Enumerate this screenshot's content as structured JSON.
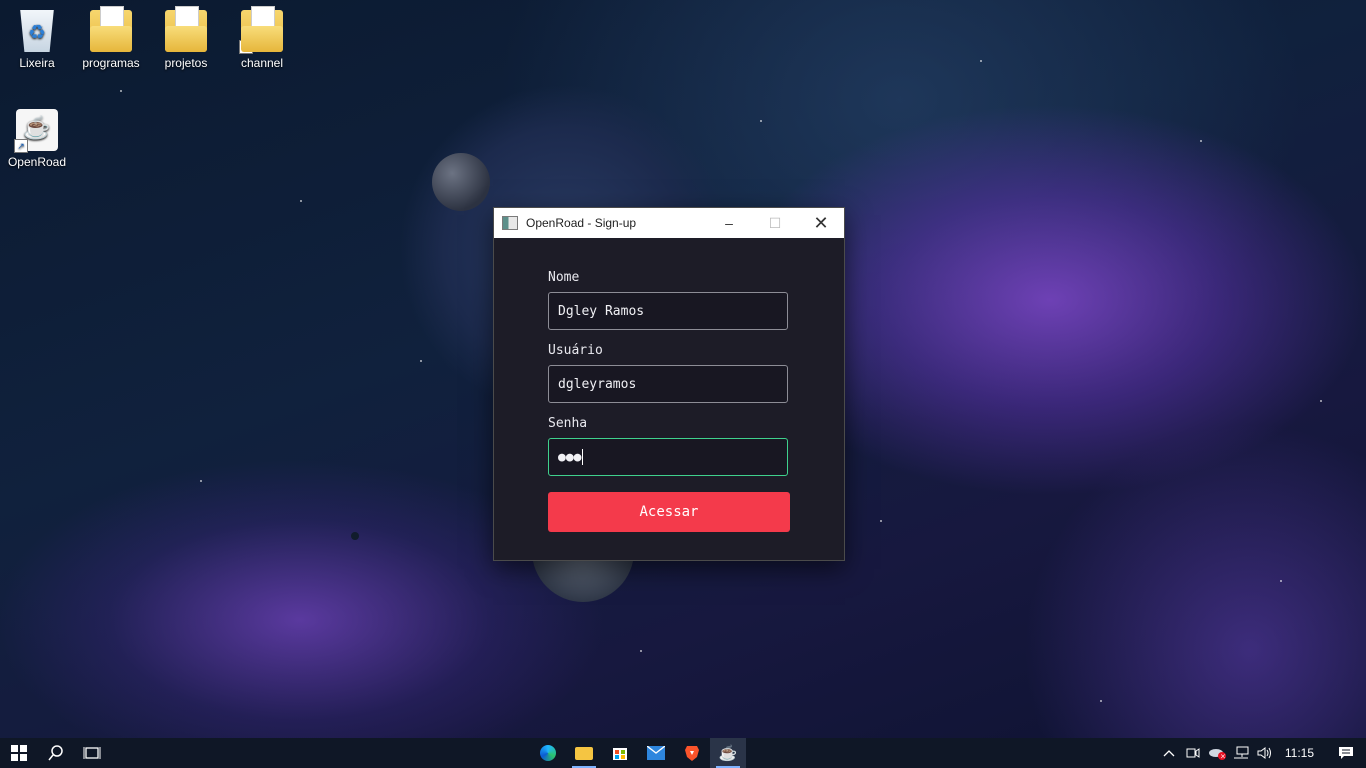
{
  "desktop": {
    "icons": [
      {
        "label": "Lixeira"
      },
      {
        "label": "programas"
      },
      {
        "label": "projetos"
      },
      {
        "label": "channel"
      },
      {
        "label": "OpenRoad"
      }
    ]
  },
  "window": {
    "title": "OpenRoad - Sign-up",
    "controls": {
      "minimize": "–",
      "maximize": "☐",
      "close": "✕"
    },
    "fields": [
      {
        "label": "Nome",
        "value": "Dgley Ramos"
      },
      {
        "label": "Usuário",
        "value": "dgleyramos"
      },
      {
        "label": "Senha",
        "value": "●●●"
      }
    ],
    "submit_label": "Acessar"
  },
  "taskbar": {
    "clock": "11:15"
  },
  "colors": {
    "accent_button": "#f43a4b",
    "focus_border": "#3fd18d",
    "window_bg": "#1d1c27"
  }
}
